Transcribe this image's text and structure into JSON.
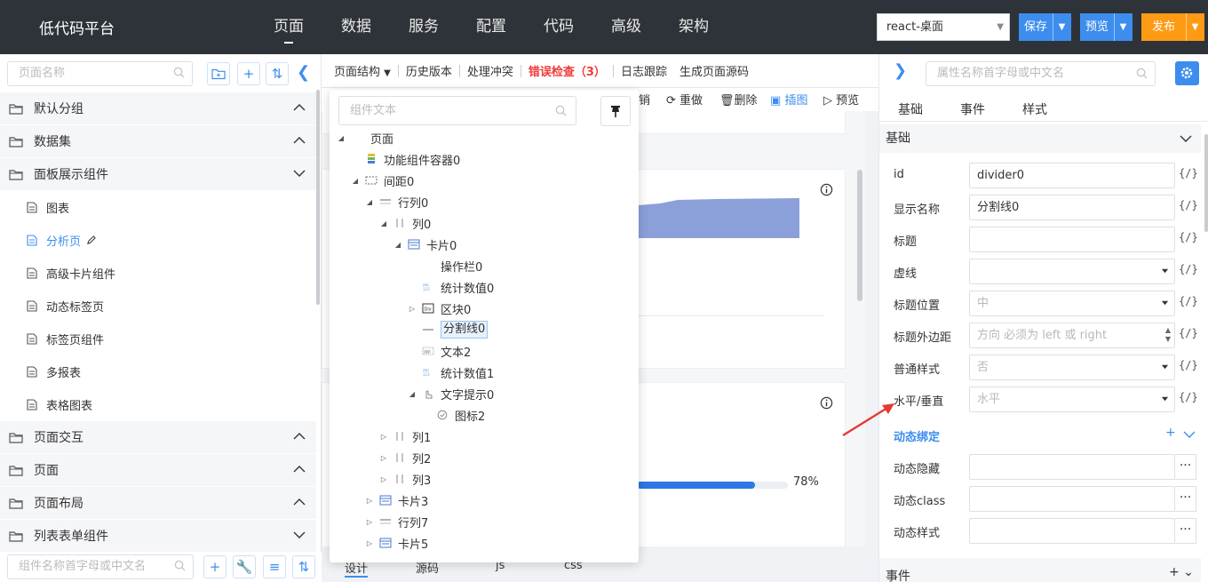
{
  "topbar": {
    "brand": "低代码平台",
    "nav": [
      "页面",
      "数据",
      "服务",
      "配置",
      "代码",
      "高级",
      "架构"
    ],
    "platform": "react-桌面",
    "save": "保存",
    "preview": "预览",
    "publish": "发布"
  },
  "sidebar": {
    "search_placeholder": "页面名称",
    "bottom_search_placeholder": "组件名称首字母或中文名",
    "groups": {
      "g0": "默认分组",
      "g1": "数据集",
      "g2": "面板展示组件",
      "g3": "页面交互",
      "g4": "页面",
      "g5": "页面布局",
      "g6": "列表表单组件"
    },
    "items": [
      "图表",
      "分析页",
      "高级卡片组件",
      "动态标签页",
      "标签页组件",
      "多报表",
      "表格图表"
    ]
  },
  "toolbar": {
    "structure": "页面结构",
    "history": "历史版本",
    "conflict": "处理冲突",
    "errors": "错误检查（3）",
    "log": "日志跟踪",
    "gen": "生成页面源码"
  },
  "subtool": {
    "undo": "销",
    "redo": "重做",
    "delete": "删除",
    "image": "插图",
    "preview": "预览"
  },
  "canvas": {
    "progress_label": "78%",
    "progress_value": 0.78
  },
  "bottom_tabs": [
    "设计",
    "源码",
    "js",
    "css"
  ],
  "tree": {
    "search_placeholder": "组件文本",
    "nodes": [
      "页面",
      "功能组件容器0",
      "间距0",
      "行列0",
      "列0",
      "卡片0",
      "操作栏0",
      "统计数值0",
      "区块0",
      "分割线0",
      "文本2",
      "统计数值1",
      "文字提示0",
      "图标2",
      "列1",
      "列2",
      "列3",
      "卡片3",
      "行列7",
      "卡片5"
    ]
  },
  "rpanel": {
    "search_placeholder": "属性名称首字母或中文名",
    "tabs": [
      "基础",
      "事件",
      "样式"
    ],
    "section_basic": "基础",
    "rows": {
      "id": {
        "label": "id",
        "value": "divider0"
      },
      "name": {
        "label": "显示名称",
        "value": "分割线0"
      },
      "title": {
        "label": "标题",
        "value": ""
      },
      "dashed": {
        "label": "虚线",
        "value": ""
      },
      "pos": {
        "label": "标题位置",
        "value": "中"
      },
      "margin": {
        "label": "标题外边距",
        "placeholder": "方向 必须为 left 或 right"
      },
      "plain": {
        "label": "普通样式",
        "value": "否"
      },
      "dir": {
        "label": "水平/垂直",
        "value": "水平"
      }
    },
    "brace": "{/}",
    "dynamic_title": "动态绑定",
    "dyn_rows": {
      "hide": "动态隐藏",
      "cls": "动态class",
      "style": "动态样式"
    },
    "more": "···",
    "events": "事件"
  },
  "colors": {
    "accent": "#3c8dee",
    "publish": "#ff9a15",
    "topbar": "#2e3339",
    "error": "#f23b3b",
    "annotation": "#e53935"
  }
}
